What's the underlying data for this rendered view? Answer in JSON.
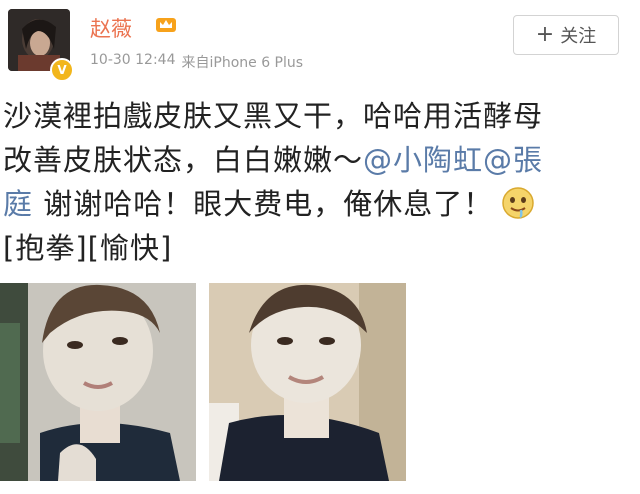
{
  "post": {
    "author": {
      "name": "赵薇",
      "avatar_icon": "avatar-portrait-icon",
      "verified_icon": "verified-v-icon",
      "badge_icon": "member-crown-icon"
    },
    "timestamp": "10-30 12:44",
    "source": "来自iPhone 6 Plus",
    "follow_button": {
      "icon": "plus-icon",
      "label": "关注"
    },
    "text": {
      "line1": "沙漠裡拍戲皮肤又黑又干，哈哈用活酵母",
      "line2_plain": "改善皮肤状态，白白嫩嫩～",
      "mention1": "@小陶虹",
      "mention2_part1": "@張",
      "mention2_part2": "庭",
      "line3_plain": " 谢谢哈哈！眼大费电，俺休息了！",
      "line3_emoji": "emoji-drool-face-icon",
      "emoticons": "[抱拳][愉快]"
    },
    "images": [
      {
        "name": "photo-1",
        "icon": "face-mask-photo-1"
      },
      {
        "name": "photo-2",
        "icon": "face-mask-photo-2"
      }
    ],
    "colors": {
      "username": "#eb7350",
      "mention": "#5a7ba8",
      "meta": "#999999",
      "verified": "#f2b61b"
    }
  }
}
